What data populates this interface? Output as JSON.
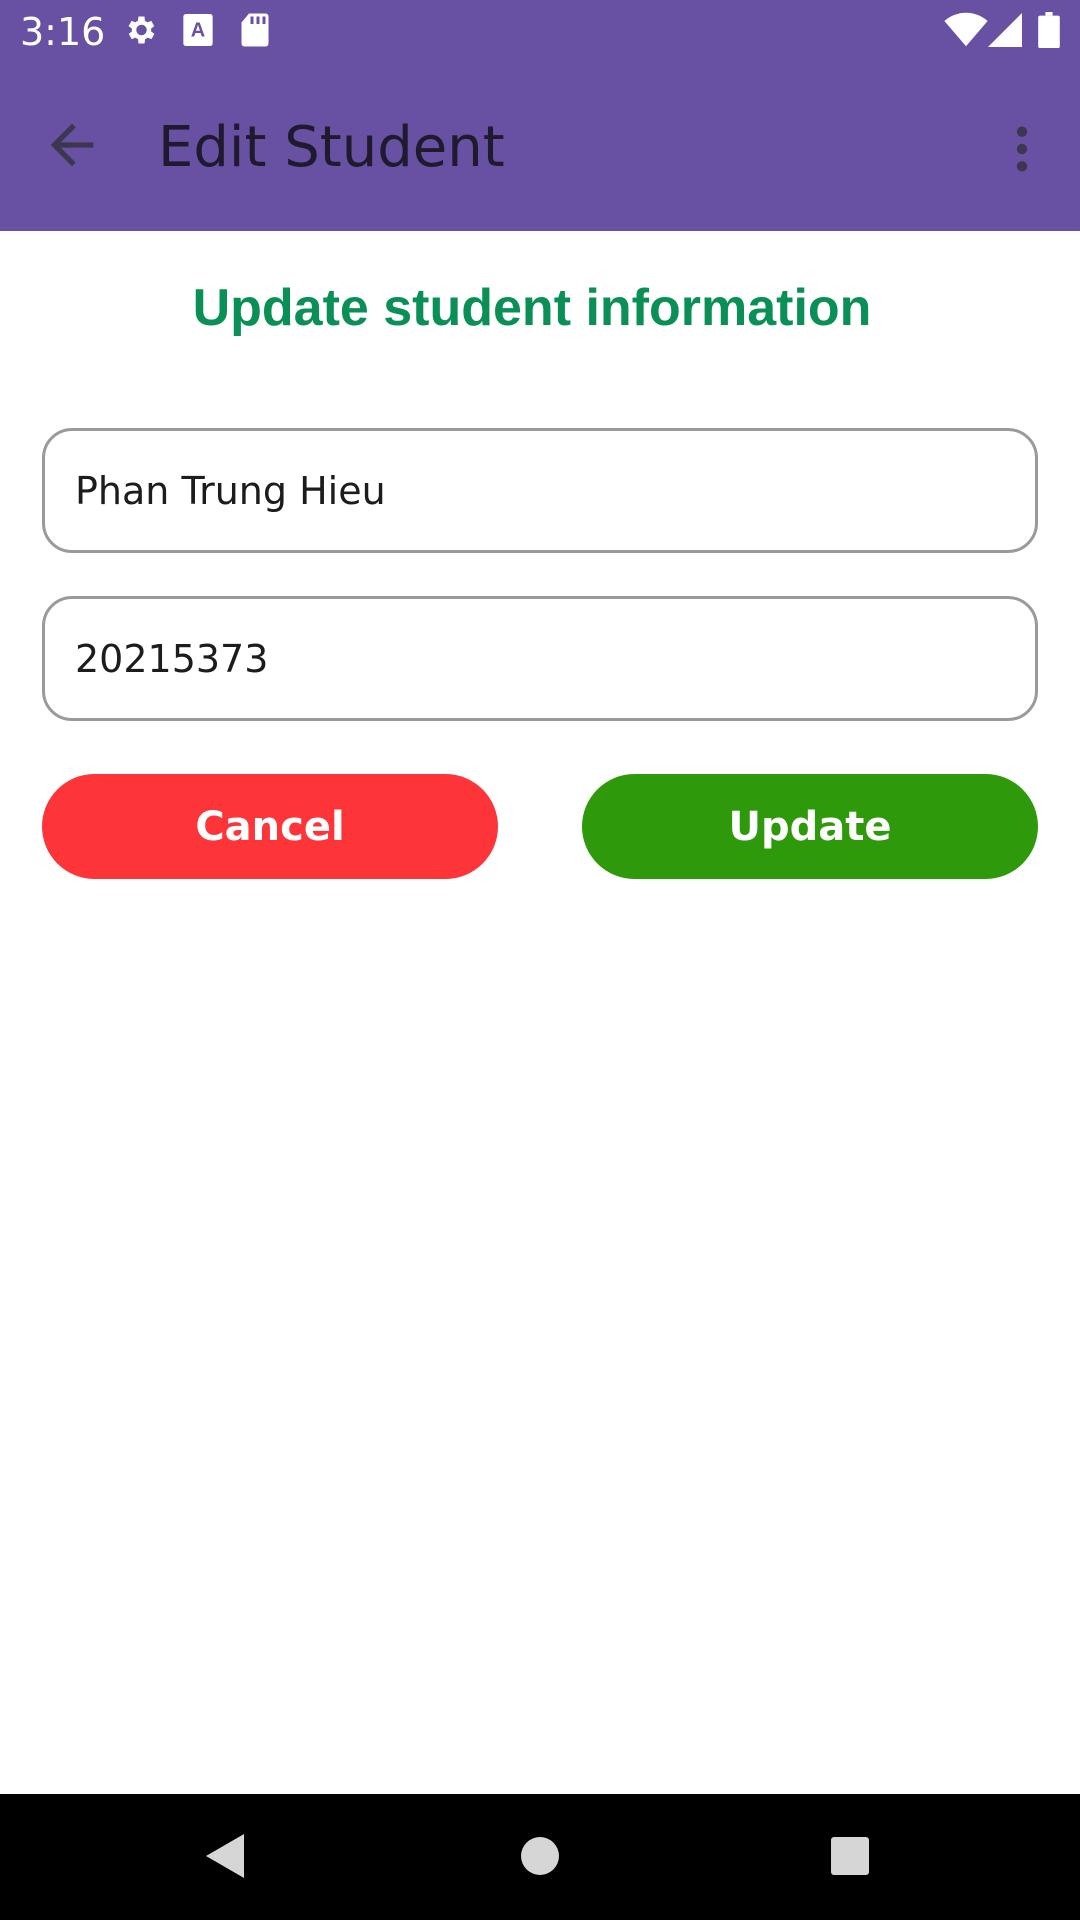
{
  "status_bar": {
    "time": "3:16",
    "left_icons": [
      "gear-icon",
      "font-icon",
      "sd-card-icon"
    ],
    "right_icons": [
      "wifi-icon",
      "signal-icon",
      "battery-icon"
    ]
  },
  "app_bar": {
    "title": "Edit Student",
    "back_icon": "arrow-left-icon",
    "more_icon": "more-vertical-icon",
    "color": "#6851a3"
  },
  "form": {
    "heading": "Update student information",
    "heading_color": "#0a8f57",
    "name_value": "Phan Trung Hieu",
    "id_value": "20215373",
    "cancel_label": "Cancel",
    "cancel_color": "#fd3539",
    "update_label": "Update",
    "update_color": "#2e990a"
  },
  "nav_bar": {
    "icons": [
      "back-triangle-icon",
      "home-circle-icon",
      "recents-square-icon"
    ]
  }
}
